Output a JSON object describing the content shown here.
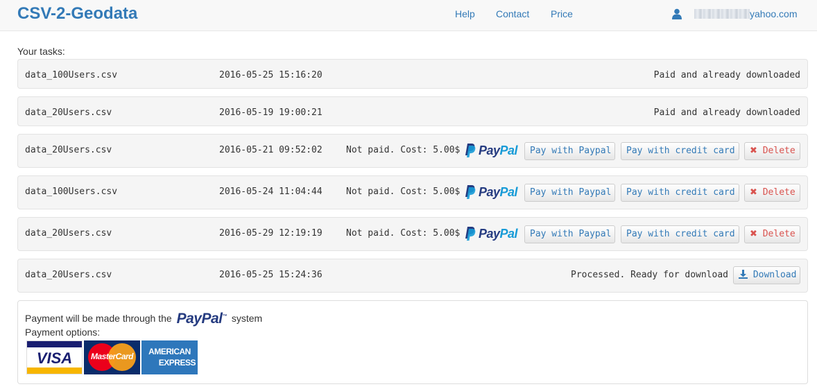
{
  "app": {
    "brand": "CSV-2-Geodata"
  },
  "nav": {
    "help": "Help",
    "contact": "Contact",
    "price": "Price"
  },
  "user": {
    "email_suffix": "yahoo.com",
    "icon": "user-icon"
  },
  "tasks_label": "Your tasks:",
  "tasks": [
    {
      "file": "data_100Users.csv",
      "date": "2016-05-25 15:16:20",
      "status": "Paid and already downloaded"
    },
    {
      "file": "data_20Users.csv",
      "date": "2016-05-19 19:00:21",
      "status": "Paid and already downloaded"
    },
    {
      "file": "data_20Users.csv",
      "date": "2016-05-21 09:52:02",
      "status": "Not paid. Cost: 5.00$"
    },
    {
      "file": "data_100Users.csv",
      "date": "2016-05-24 11:04:44",
      "status": "Not paid. Cost: 5.00$"
    },
    {
      "file": "data_20Users.csv",
      "date": "2016-05-29 12:19:19",
      "status": "Not paid. Cost: 5.00$"
    },
    {
      "file": "data_20Users.csv",
      "date": "2016-05-25 15:24:36",
      "status": "Processed. Ready for download"
    }
  ],
  "buttons": {
    "pay_paypal": "Pay with Paypal",
    "pay_card": "Pay with credit card",
    "delete": "Delete",
    "download": "Download"
  },
  "paypal_logo": {
    "pay": "Pay",
    "pal": "Pal"
  },
  "payment_info": {
    "line1_before": "Payment will be made through the",
    "line1_after": "system",
    "line2": "Payment options:"
  },
  "cards": {
    "visa": "VISA",
    "mastercard": "MasterCard",
    "amex_top": "AMERICAN",
    "amex_bottom": "EXPRESS"
  },
  "colors": {
    "brand": "#337ab7",
    "delete": "#d9534f",
    "paypal_dark": "#253b80",
    "paypal_light": "#179bd7"
  }
}
